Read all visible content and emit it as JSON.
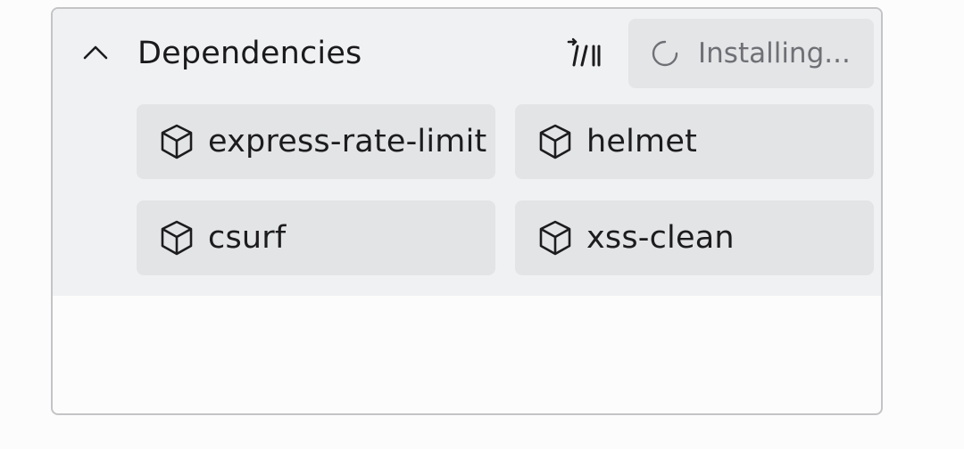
{
  "dependencies": {
    "title": "Dependencies",
    "status_label": "Installing...",
    "packages": [
      {
        "name": "express-rate-limit",
        "icon": "package-icon"
      },
      {
        "name": "helmet",
        "icon": "package-icon"
      },
      {
        "name": "csurf",
        "icon": "package-icon"
      },
      {
        "name": "xss-clean",
        "icon": "package-icon"
      }
    ],
    "icons": {
      "collapse": "chevron-up-icon",
      "action": "list-sparkle-icon",
      "status": "loading-spinner-icon"
    },
    "colors": {
      "section_background": "#f0f1f3",
      "chip_background": "#e3e4e6",
      "status_text": "#6f7075",
      "border": "#c4c4c7"
    }
  }
}
